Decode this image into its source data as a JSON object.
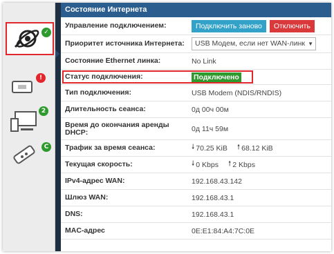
{
  "sidebar": {
    "items": [
      {
        "name": "internet",
        "icon": "globe-network-icon",
        "badge": "✓",
        "badge_color": "#2e9a2e",
        "active": true
      },
      {
        "name": "sms",
        "icon": "router-device-icon",
        "badge": "!",
        "badge_color": "#e3262b"
      },
      {
        "name": "devices",
        "icon": "devices-icon",
        "badge": "2",
        "badge_color": "#2e9a2e"
      },
      {
        "name": "usb",
        "icon": "usb-modem-icon",
        "badge": "C",
        "badge_color": "#2e9a2e"
      }
    ]
  },
  "panel": {
    "title": "Состояние Интернета",
    "rows": {
      "control": {
        "label": "Управление подключением:",
        "reconnect": "Подключить заново",
        "disconnect": "Отключить"
      },
      "priority": {
        "label": "Приоритет источника Интернета:",
        "value": "USB Модем, если нет WAN-линк"
      },
      "ethernet": {
        "label": "Состояние Ethernet линка:",
        "value": "No Link"
      },
      "status": {
        "label": "Статус подключения:",
        "value": "Подключено"
      },
      "type": {
        "label": "Тип подключения:",
        "value": "USB Modem (NDIS/RNDIS)"
      },
      "duration": {
        "label": "Длительность сеанса:",
        "value": "0д 00ч 00м"
      },
      "lease": {
        "label": "Время до окончания аренды DHCP:",
        "value": "0д 11ч 59м"
      },
      "traffic": {
        "label": "Трафик за время сеанса:",
        "down": "70.25 KiB",
        "up": "68.12 KiB"
      },
      "speed": {
        "label": "Текущая скорость:",
        "down": "0 Kbps",
        "up": "2 Kbps"
      },
      "ipv4": {
        "label": "IPv4-адрес WAN:",
        "value": "192.168.43.142"
      },
      "gateway": {
        "label": "Шлюз WAN:",
        "value": "192.168.43.1"
      },
      "dns": {
        "label": "DNS:",
        "value": "192.168.43.1"
      },
      "mac": {
        "label": "MAC-адрес",
        "value": "0E:E1:84:A4:7C:0E"
      }
    }
  },
  "colors": {
    "accent": "#2c5d8f",
    "ok": "#2e9a2e",
    "highlight": "#e3262b"
  }
}
